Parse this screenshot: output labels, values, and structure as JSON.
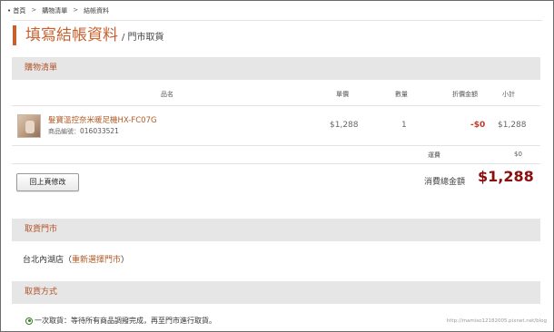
{
  "breadcrumb": {
    "items": [
      "首頁",
      "購物清單",
      "結帳資料"
    ],
    "separator": ">"
  },
  "heading": {
    "title": "填寫結帳資料",
    "subtitle": "/ 門市取貨"
  },
  "cart": {
    "section_title": "購物清單",
    "columns": {
      "name": "品名",
      "price": "單價",
      "qty": "數量",
      "discount": "折價金額",
      "subtotal": "小計"
    },
    "item": {
      "name": "髮寶溫控奈米暖足機HX-FC07G",
      "code_label": "商品編號：",
      "code": "016033521",
      "price": "$1,288",
      "qty": "1",
      "discount": "-$0",
      "subtotal": "$1,288"
    },
    "shipping_label": "運費",
    "shipping_value": "$0",
    "back_button": "回上頁修改",
    "total_label": "消費總金額",
    "total_value": "$1,288"
  },
  "store": {
    "section_title": "取貨門市",
    "name": "台北內湖店",
    "open_paren": "（",
    "reselect_link": "重新選擇門市",
    "close_paren": "）"
  },
  "method": {
    "section_title": "取貨方式",
    "option_text": "一次取貨：等待所有商品調撥完成，再至門市進行取貨。"
  },
  "watermark": "http://mamiso12182005.pixnet.net/blog",
  "colors": {
    "accent": "#c8602d",
    "section_bar": "#e6e6e6",
    "total": "#8b0e0e",
    "discount": "#c0392b"
  }
}
